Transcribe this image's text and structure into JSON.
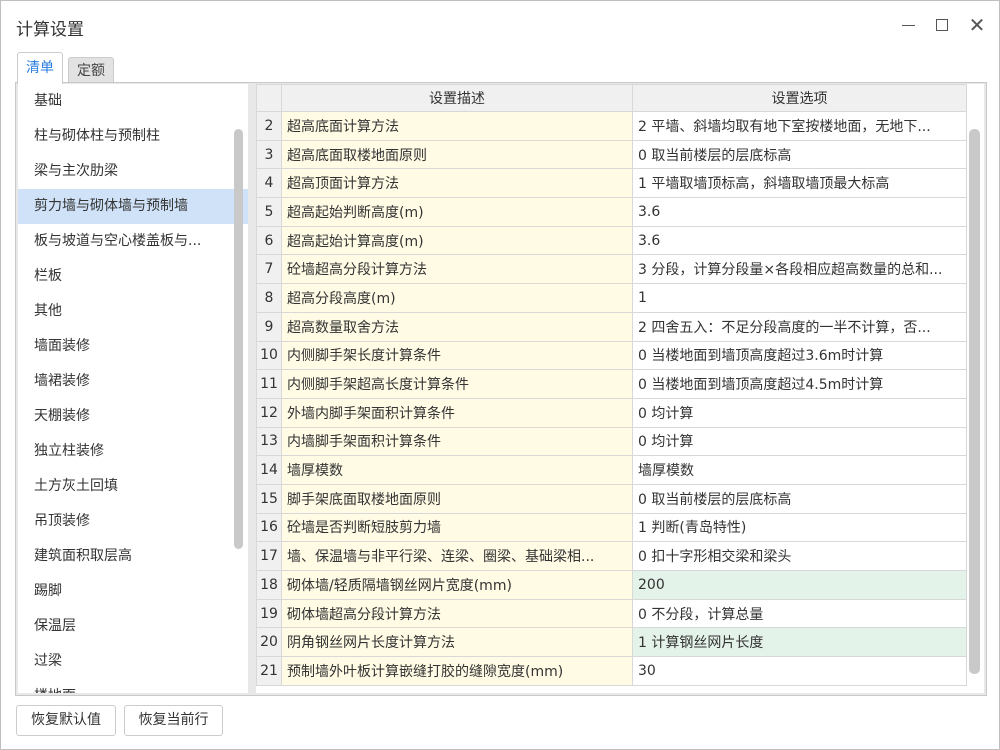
{
  "window": {
    "title": "计算设置"
  },
  "tabs": [
    {
      "label": "清单",
      "active": true
    },
    {
      "label": "定额",
      "active": false
    }
  ],
  "categories": [
    "基础",
    "柱与砌体柱与预制柱",
    "梁与主次肋梁",
    "剪力墙与砌体墙与预制墙",
    "板与坡道与空心楼盖板与...",
    "栏板",
    "其他",
    "墙面装修",
    "墙裙装修",
    "天棚装修",
    "独立柱装修",
    "土方灰土回填",
    "吊顶装修",
    "建筑面积取层高",
    "踢脚",
    "保温层",
    "过梁",
    "楼地面"
  ],
  "selected_category": "剪力墙与砌体墙与预制墙",
  "table": {
    "headers": [
      "",
      "设置描述",
      "设置选项"
    ],
    "rows": [
      {
        "n": "2",
        "desc": "超高底面计算方法",
        "opt": "2 平墙、斜墙均取有地下室按楼地面，无地下..."
      },
      {
        "n": "3",
        "desc": "超高底面取楼地面原则",
        "opt": "0 取当前楼层的层底标高"
      },
      {
        "n": "4",
        "desc": "超高顶面计算方法",
        "opt": "1 平墙取墙顶标高，斜墙取墙顶最大标高"
      },
      {
        "n": "5",
        "desc": "超高起始判断高度(m)",
        "opt": "3.6"
      },
      {
        "n": "6",
        "desc": "超高起始计算高度(m)",
        "opt": "3.6"
      },
      {
        "n": "7",
        "desc": "砼墙超高分段计算方法",
        "opt": "3 分段，计算分段量×各段相应超高数量的总和..."
      },
      {
        "n": "8",
        "desc": "超高分段高度(m)",
        "opt": "1"
      },
      {
        "n": "9",
        "desc": "超高数量取舍方法",
        "opt": "2 四舍五入：不足分段高度的一半不计算，否..."
      },
      {
        "n": "10",
        "desc": "内侧脚手架长度计算条件",
        "opt": "0 当楼地面到墙顶高度超过3.6m时计算"
      },
      {
        "n": "11",
        "desc": "内侧脚手架超高长度计算条件",
        "opt": "0 当楼地面到墙顶高度超过4.5m时计算"
      },
      {
        "n": "12",
        "desc": "外墙内脚手架面积计算条件",
        "opt": "0 均计算"
      },
      {
        "n": "13",
        "desc": "内墙脚手架面积计算条件",
        "opt": "0 均计算"
      },
      {
        "n": "14",
        "desc": "墙厚模数",
        "opt": "墙厚模数"
      },
      {
        "n": "15",
        "desc": "脚手架底面取楼地面原则",
        "opt": "0 取当前楼层的层底标高"
      },
      {
        "n": "16",
        "desc": "砼墙是否判断短肢剪力墙",
        "opt": "1 判断(青岛特性)"
      },
      {
        "n": "17",
        "desc": "墙、保温墙与非平行梁、连梁、圈梁、基础梁相...",
        "opt": "0 扣十字形相交梁和梁头"
      },
      {
        "n": "18",
        "desc": "砌体墙/轻质隔墙钢丝网片宽度(mm)",
        "opt": "200",
        "modified": true
      },
      {
        "n": "19",
        "desc": "砌体墙超高分段计算方法",
        "opt": "0 不分段，计算总量"
      },
      {
        "n": "20",
        "desc": "阴角钢丝网片长度计算方法",
        "opt": "1 计算钢丝网片长度",
        "modified": true
      },
      {
        "n": "21",
        "desc": "预制墙外叶板计算嵌缝打胶的缝隙宽度(mm)",
        "opt": "30"
      }
    ]
  },
  "buttons": {
    "restore_default": "恢复默认值",
    "restore_row": "恢复当前行"
  },
  "colors": {
    "accent": "#2a7ee0",
    "desc_bg": "#fffbe5",
    "modified_bg": "#e4f3ea",
    "selected_bg": "#cfe2f7"
  }
}
